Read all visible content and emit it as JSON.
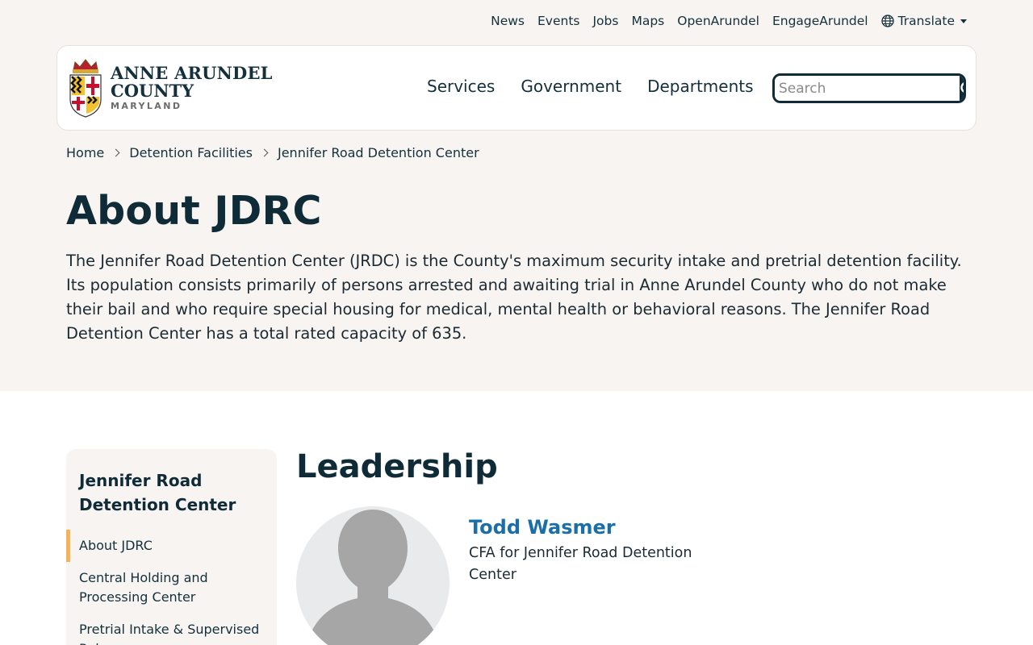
{
  "utility_nav": {
    "links": [
      "News",
      "Events",
      "Jobs",
      "Maps",
      "OpenArundel",
      "EngageArundel"
    ],
    "translate_label": "Translate"
  },
  "logo": {
    "line1": "ANNE ARUNDEL",
    "line2": "COUNTY",
    "line3": "MARYLAND"
  },
  "main_nav": [
    "Services",
    "Government",
    "Departments"
  ],
  "search": {
    "placeholder": "Search"
  },
  "breadcrumb": [
    "Home",
    "Detention Facilities",
    "Jennifer Road Detention Center"
  ],
  "hero": {
    "title": "About JDRC",
    "intro": "The Jennifer Road Detention Center (JRDC) is the County's maximum security intake and pretrial detention facility. Its population consists primarily of persons arrested and awaiting trial in Anne Arundel County who do not make their bail and who require special housing for medical, mental health or behavioral reasons. The Jennifer Road Detention Center has a total rated capacity of 635."
  },
  "sidebar": {
    "title": "Jennifer Road Detention Center",
    "items": [
      "About JDRC",
      "Central Holding and Processing Center",
      "Pretrial Intake & Supervised Release"
    ]
  },
  "leadership": {
    "title": "Leadership",
    "name": "Todd Wasmer",
    "role": "CFA for Jennifer Road Detention Center"
  },
  "colors": {
    "primary": "#0f2b38",
    "link": "#1a6fa8",
    "accent": "#f2b35a",
    "background": "#f7f4f1"
  }
}
